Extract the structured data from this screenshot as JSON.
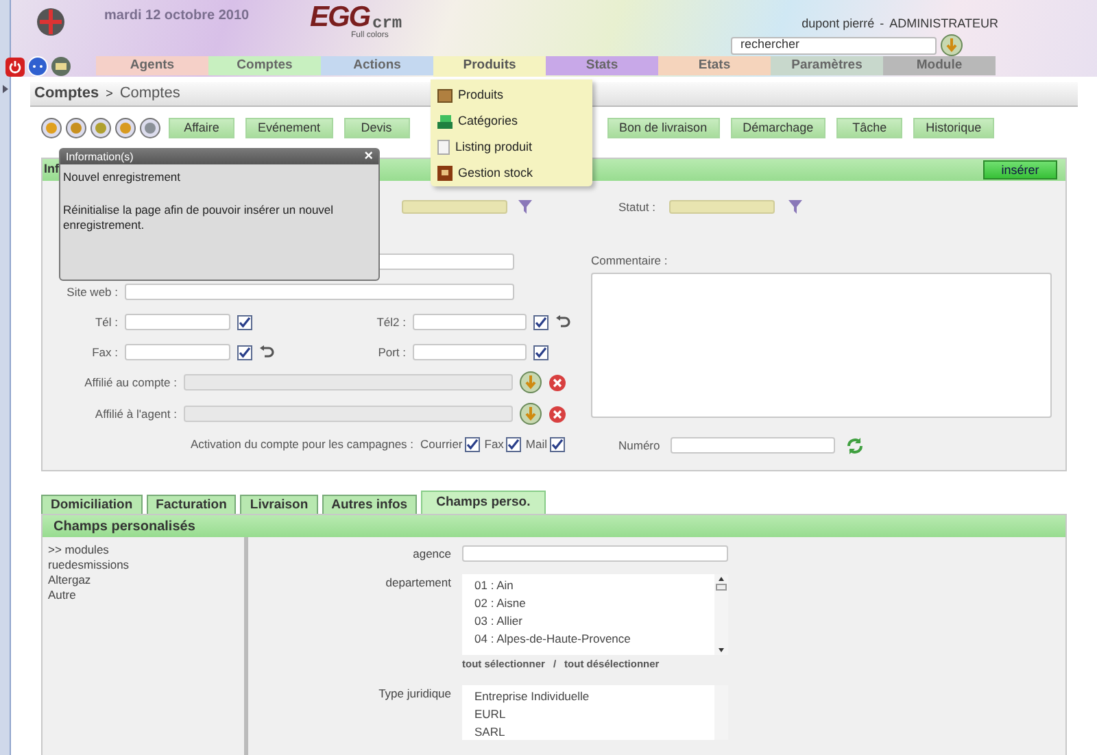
{
  "header": {
    "date": "mardi 12 octobre 2010",
    "logo_main": "EGG",
    "logo_sub": "crm",
    "logo_tagline": "Full colors",
    "user": "dupont pierré",
    "separator": "-",
    "role": "ADMINISTRATEUR",
    "search_value": "rechercher"
  },
  "menu": [
    {
      "label": "Agents",
      "color": "#f5d0c8",
      "selected": false
    },
    {
      "label": "Comptes",
      "color": "#c8f0c0",
      "selected": false
    },
    {
      "label": "Actions",
      "color": "#c4d8f0",
      "selected": false
    },
    {
      "label": "Produits",
      "color": "#f5f3c0",
      "selected": true
    },
    {
      "label": "Stats",
      "color": "#c8a8e8",
      "selected": false
    },
    {
      "label": "Etats",
      "color": "#f5d4bc",
      "selected": false
    },
    {
      "label": "Paramètres",
      "color": "#c8d8cc",
      "selected": false
    },
    {
      "label": "Module",
      "color": "#b8b8b8",
      "selected": false
    }
  ],
  "dropdown": [
    {
      "label": "Produits",
      "kind": "box"
    },
    {
      "label": "Catégories",
      "kind": "stack"
    },
    {
      "label": "Listing produit",
      "kind": "page"
    },
    {
      "label": "Gestion stock",
      "kind": "safe"
    }
  ],
  "breadcrumb": {
    "root": "Comptes",
    "separator": ">",
    "current": "Comptes"
  },
  "action_buttons": [
    "Affaire",
    "Evénement",
    "Devis"
  ],
  "action_buttons_right": [
    "Bon de livraison",
    "Démarchage",
    "Tâche",
    "Historique"
  ],
  "popup": {
    "title": "Information(s)",
    "close": "×",
    "heading": "Nouvel enregistrement",
    "text": "Réinitialise la page afin de pouvoir insérer un nouvel enregistrement."
  },
  "info_panel": {
    "heading": "Inf",
    "insert_button": "insérer",
    "statut_label": "Statut :",
    "site_label": "Site web :",
    "tel_label": "Tél :",
    "tel_checked": true,
    "tel2_label": "Tél2 :",
    "tel2_checked": true,
    "fax_label": "Fax :",
    "fax_checked": true,
    "port_label": "Port :",
    "port_checked": true,
    "affil_compte_label": "Affilié au compte :",
    "affil_agent_label": "Affilié à l'agent :",
    "activation_label": "Activation du compte pour les campagnes :",
    "campaigns": [
      {
        "label": "Courrier",
        "checked": true
      },
      {
        "label": "Fax",
        "checked": true
      },
      {
        "label": "Mail",
        "checked": true
      }
    ],
    "comment_label": "Commentaire :",
    "numero_label": "Numéro"
  },
  "tabs": [
    {
      "label": "Domiciliation",
      "selected": false
    },
    {
      "label": "Facturation",
      "selected": false
    },
    {
      "label": "Livraison",
      "selected": false
    },
    {
      "label": "Autres infos",
      "selected": false
    },
    {
      "label": "Champs perso.",
      "selected": true
    }
  ],
  "custom_panel": {
    "heading": "Champs personalisés",
    "modules": [
      ">> modules",
      "ruedesmissions",
      "Altergaz",
      "Autre"
    ],
    "agence_label": "agence",
    "departement_label": "departement",
    "departements": [
      "01 : Ain",
      "02 : Aisne",
      "03 : Allier",
      "04 : Alpes-de-Haute-Provence"
    ],
    "select_all": "tout sélectionner",
    "link_separator": "/",
    "deselect_all": "tout désélectionner",
    "type_label": "Type juridique",
    "types": [
      "Entreprise Individuelle",
      "EURL",
      "SARL"
    ]
  }
}
